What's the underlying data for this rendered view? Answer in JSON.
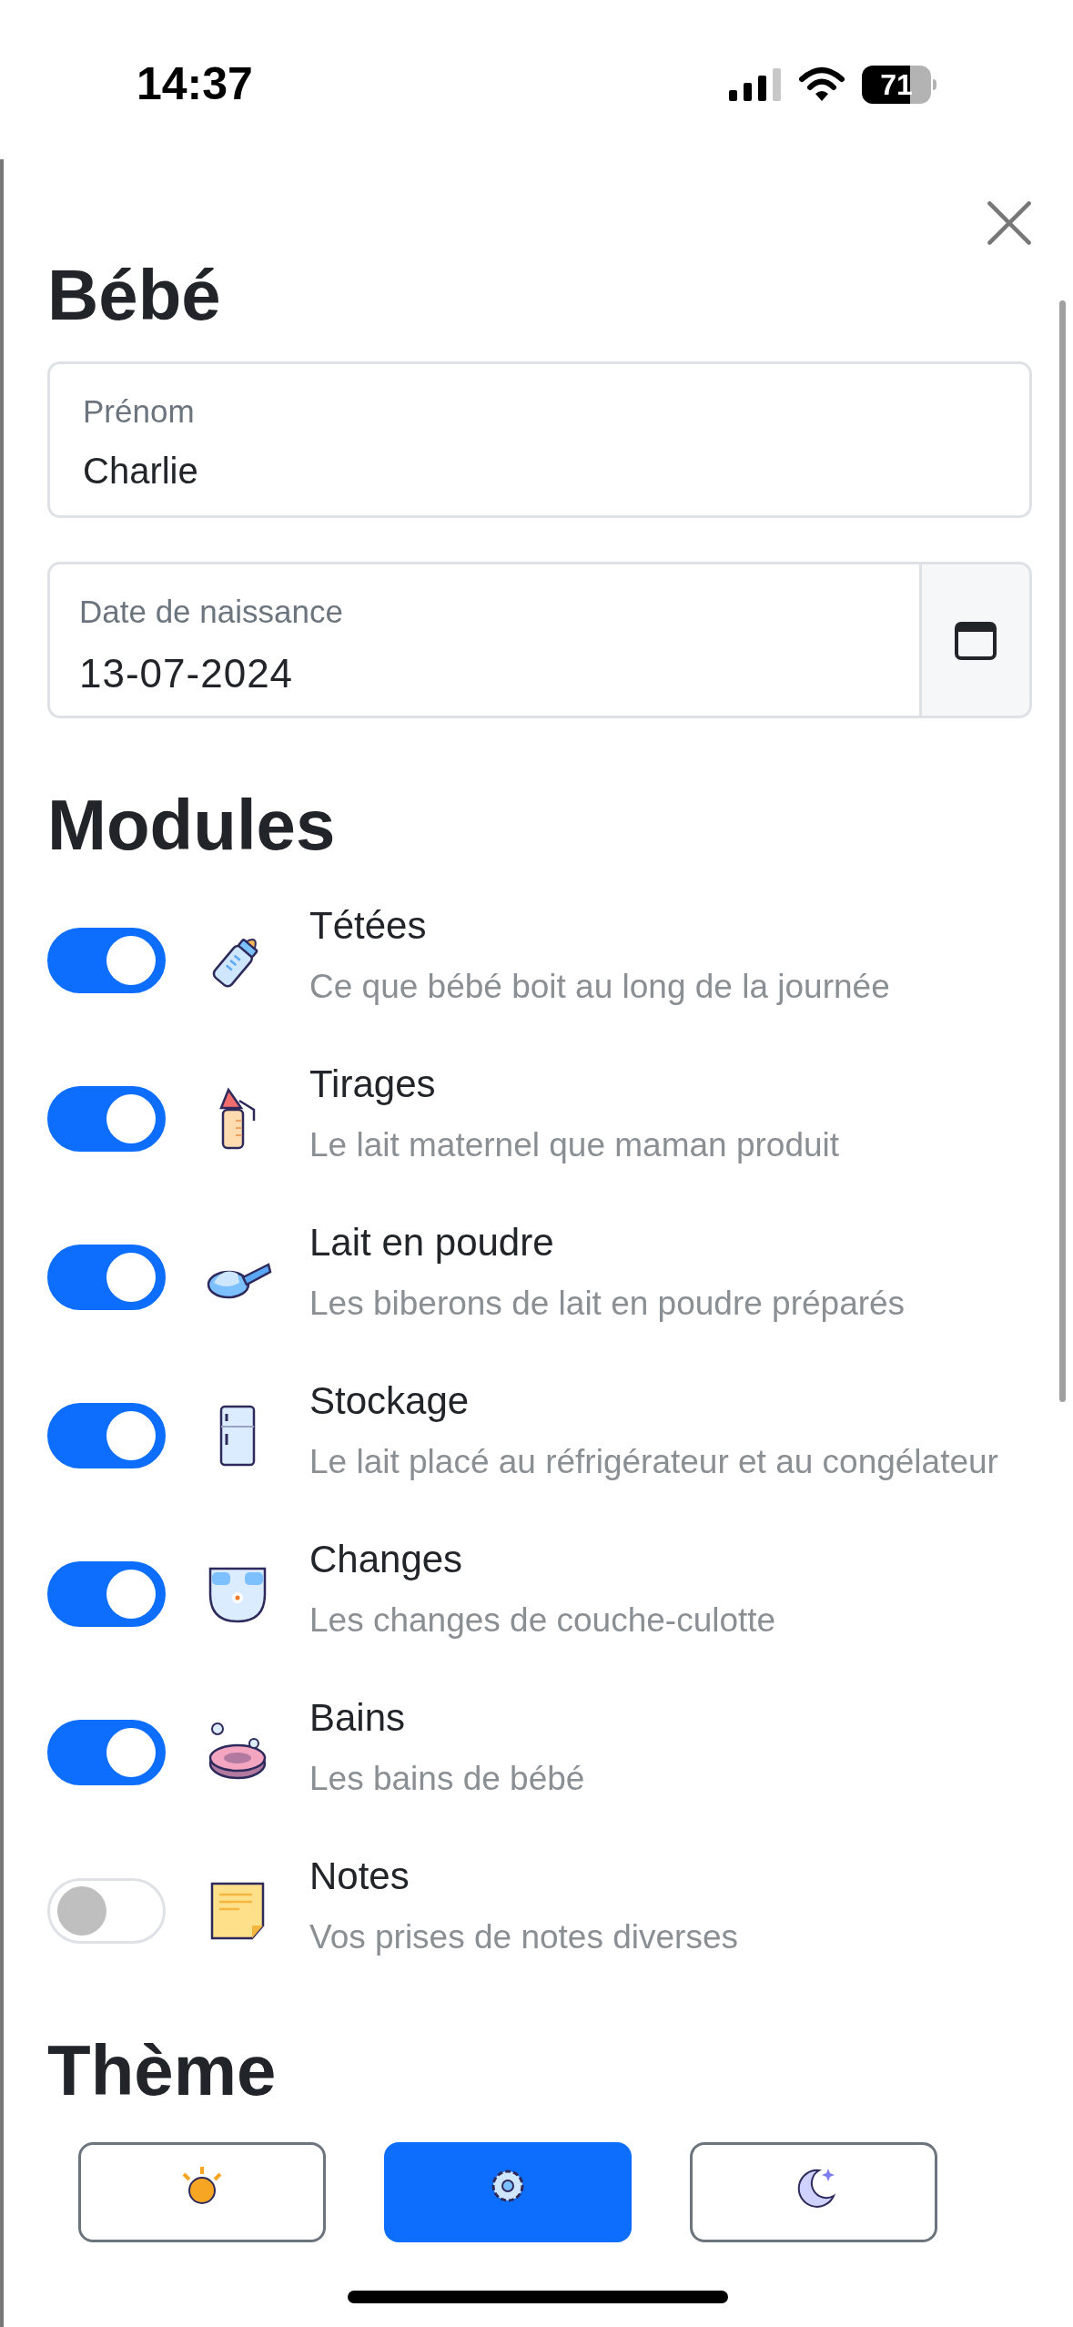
{
  "status_bar": {
    "time": "14:37",
    "battery": "71"
  },
  "baby": {
    "title": "Bébé",
    "first_name": {
      "label": "Prénom",
      "value": "Charlie"
    },
    "birth_date": {
      "label": "Date de naissance",
      "value": "13-07-2024"
    }
  },
  "modules": {
    "title": "Modules",
    "items": [
      {
        "kind": "bottle",
        "name": "Tétées",
        "description": "Ce que bébé boit au long de la journée",
        "on": true
      },
      {
        "kind": "pump",
        "name": "Tirages",
        "description": "Le lait maternel que maman produit",
        "on": true
      },
      {
        "kind": "scoop",
        "name": "Lait en poudre",
        "description": "Les biberons de lait en poudre préparés",
        "on": true
      },
      {
        "kind": "fridge",
        "name": "Stockage",
        "description": "Le lait placé au réfrigérateur et au congélateur",
        "on": true
      },
      {
        "kind": "diaper",
        "name": "Changes",
        "description": "Les changes de couche-culotte",
        "on": true
      },
      {
        "kind": "bath",
        "name": "Bains",
        "description": "Les bains de bébé",
        "on": true
      },
      {
        "kind": "note",
        "name": "Notes",
        "description": "Vos prises de notes diverses",
        "on": false
      }
    ]
  },
  "theme": {
    "title": "Thème",
    "options": [
      {
        "kind": "sun",
        "selected": false
      },
      {
        "kind": "gear",
        "selected": true
      },
      {
        "kind": "moon",
        "selected": false
      }
    ]
  }
}
